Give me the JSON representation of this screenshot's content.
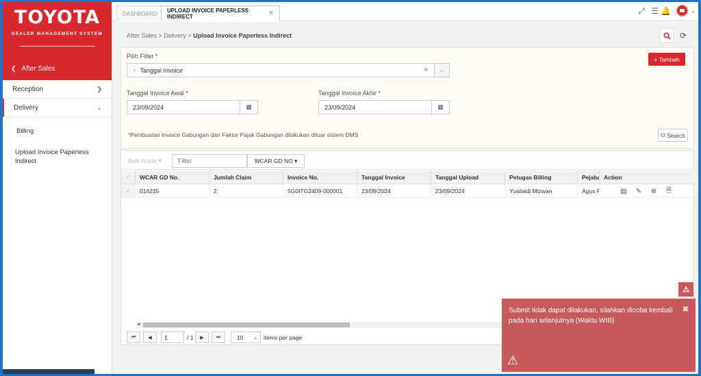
{
  "sidebar": {
    "brand": "TOYOTA",
    "brand_sub": "DEALER MANAGEMENT SYSTEM",
    "back_label": "After Sales",
    "items": [
      {
        "label": "Reception"
      },
      {
        "label": "Delivery"
      }
    ],
    "sub_items": [
      {
        "label": "Billing"
      },
      {
        "label": "Upload Invoice Paperless Indirect"
      }
    ]
  },
  "tabs": [
    {
      "label": "DASHBOARD"
    },
    {
      "label": "UPLOAD INVOICE PAPERLESS INDIRECT"
    }
  ],
  "breadcrumb": {
    "part1": "After Sales",
    "part2": "Delivery",
    "current": "Upload Invoice Paperless Indirect"
  },
  "filter": {
    "label": "Pilih Filter *",
    "value": "Tanggal Invoice",
    "start_label": "Tanggal Invoice Awal *",
    "start_value": "23/09/2024",
    "end_label": "Tanggal Invoice Akhir *",
    "end_value": "23/09/2024",
    "note": "*Pembuatan Invoice Gabungan dan Faktur Pajak Gabungan dilakukan diluar sistem DMS",
    "add_label": "+ Tambah",
    "search_label": "Search"
  },
  "grid": {
    "bulk_action": "Bulk Action",
    "filter_placeholder": "Filter",
    "field_select": "WCAR GD NO",
    "columns": [
      "WCAR GD No.",
      "Jumlah Claim",
      "Invoice No.",
      "Tanggal Invoice",
      "Tanggal Upload",
      "Petugas Billing",
      "Pejabat",
      "Action"
    ],
    "rows": [
      {
        "wcar": "016235",
        "jumlah": "2",
        "invoice": "5G0ITG2409-000001",
        "tgl_invoice": "23/09/2024",
        "tgl_upload": "23/09/2024",
        "petugas": "Yusilaidi Mizwan",
        "pejabat": "Agus P"
      }
    ]
  },
  "pager": {
    "page": "1",
    "total": "/ 1",
    "per_page": "10",
    "per_page_label": "items per page"
  },
  "toast": {
    "message": "Submit tidak dapat dilakukan, silahkan dicoba kembali pada hari selanjutnya (Waktu WIB)"
  },
  "colors": {
    "brand_red": "#d8282e",
    "toast_bg": "#c8595a",
    "frame_blue": "#1e73c9"
  }
}
